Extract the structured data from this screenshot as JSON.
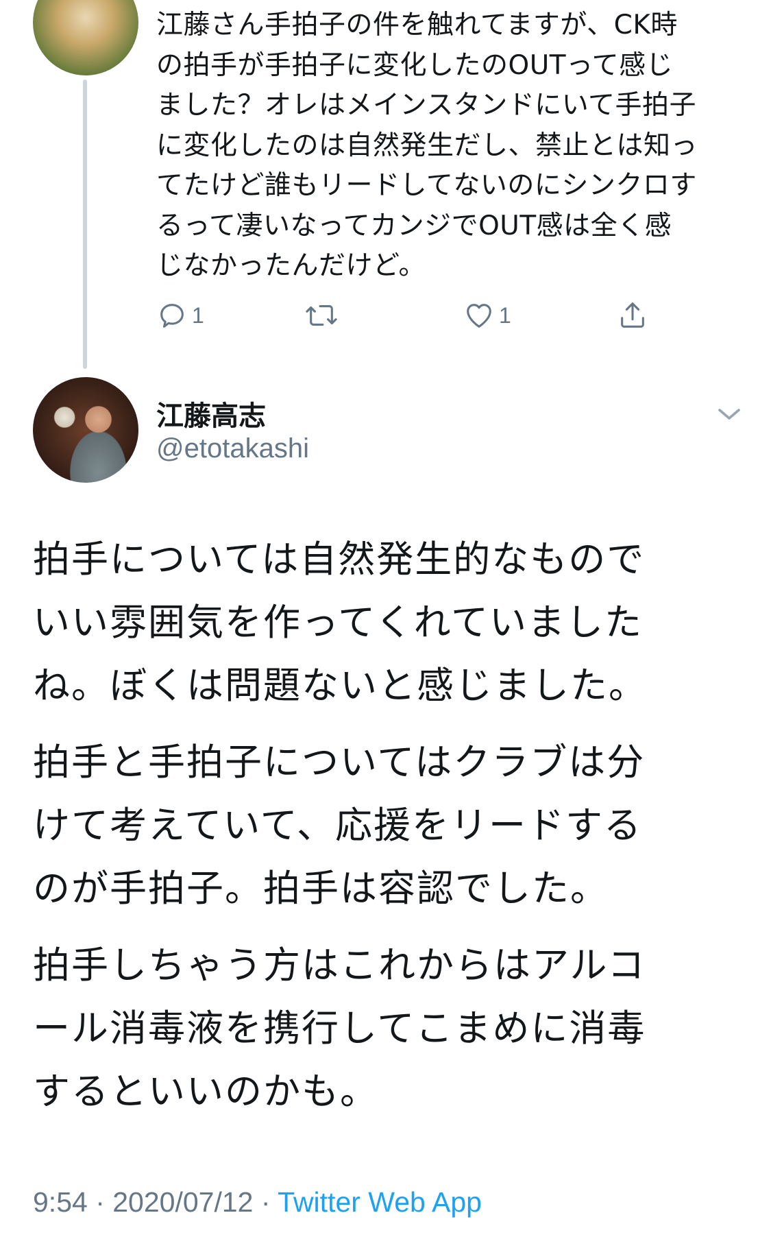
{
  "parent_tweet": {
    "avatar_icon": "parent-avatar",
    "text": "江藤さん手拍子の件を触れてますが、CK時\nの拍手が手拍子に変化したのOUTって感じ\nました？オレはメインスタンドにいて手拍子\nに変化したのは自然発生だし、禁止とは知っ\nてたけど誰もリードしてないのにシンクロす\nるって凄いなってカンジでOUT感は全く感\nじなかったんだけど。",
    "actions": {
      "reply_count": "1",
      "retweet_count": "",
      "like_count": "1"
    }
  },
  "main_tweet": {
    "author": {
      "name": "江藤高志",
      "handle": "@etotakashi"
    },
    "paragraphs": [
      "拍手については自然発生的なもので\nいい雰囲気を作ってくれていました\nね。ぼくは問題ないと感じました。",
      "拍手と手拍子についてはクラブは分\nけて考えていて、応援をリードする\nのが手拍子。拍手は容認でした。",
      "拍手しちゃう方はこれからはアルコ\nール消毒液を携行してこまめに消毒\nするといいのかも。"
    ],
    "time": "9:54",
    "separator": " · ",
    "date": "2020/07/12",
    "source": "Twitter Web App"
  },
  "colors": {
    "text": "#14171a",
    "secondary": "#657786",
    "link": "#1da1f2",
    "thread_line": "#cdd4da"
  }
}
